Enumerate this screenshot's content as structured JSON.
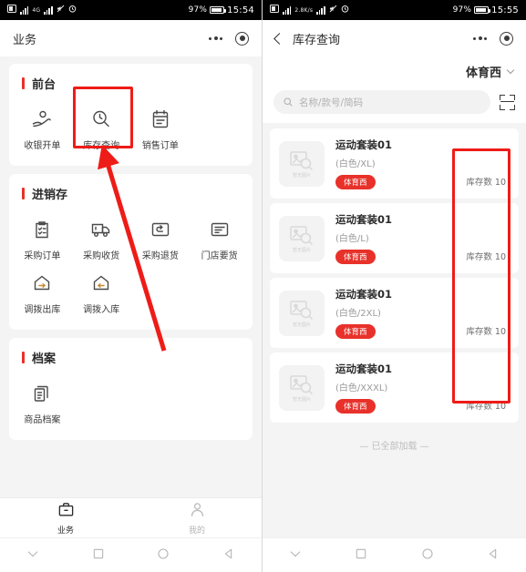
{
  "left_screen": {
    "status_bar": {
      "battery_pct": "97%",
      "time": "15:54",
      "network": "4G"
    },
    "header": {
      "title": "业务",
      "more_icon": "more-dots-icon",
      "target_icon": "target-icon"
    },
    "sections": [
      {
        "title": "前台",
        "items": [
          {
            "label": "收银开单",
            "icon": "hand-coin-icon",
            "highlighted": false
          },
          {
            "label": "库存查询",
            "icon": "search-stock-icon",
            "highlighted": true
          },
          {
            "label": "销售订单",
            "icon": "clipboard-calendar-icon",
            "highlighted": false
          }
        ]
      },
      {
        "title": "进销存",
        "items": [
          {
            "label": "采购订单",
            "icon": "clipboard-check-icon",
            "highlighted": false
          },
          {
            "label": "采购收货",
            "icon": "truck-icon",
            "highlighted": false
          },
          {
            "label": "采购退货",
            "icon": "box-return-icon",
            "highlighted": false
          },
          {
            "label": "门店要货",
            "icon": "box-request-icon",
            "highlighted": false
          },
          {
            "label": "调拨出库",
            "icon": "house-arrow-right-icon",
            "highlighted": false
          },
          {
            "label": "调拨入库",
            "icon": "house-arrow-left-icon",
            "highlighted": false
          }
        ]
      },
      {
        "title": "档案",
        "items": [
          {
            "label": "商品档案",
            "icon": "documents-icon",
            "highlighted": false
          }
        ]
      }
    ],
    "tabbar": [
      {
        "label": "业务",
        "icon": "briefcase-icon",
        "active": true
      },
      {
        "label": "我的",
        "icon": "person-icon",
        "active": false
      }
    ],
    "navbar": [
      {
        "icon": "chevron-down-icon"
      },
      {
        "icon": "square-icon"
      },
      {
        "icon": "circle-icon"
      },
      {
        "icon": "triangle-back-icon"
      }
    ]
  },
  "right_screen": {
    "status_bar": {
      "battery_pct": "97%",
      "time": "15:55",
      "network": "2.8K/s"
    },
    "header": {
      "title": "库存查询",
      "back_icon": "back-chevron-icon",
      "more_icon": "more-dots-icon",
      "target_icon": "target-icon"
    },
    "store_selector": {
      "name": "体育西",
      "chevron_icon": "chevron-down-icon"
    },
    "search": {
      "placeholder": "名称/款号/简码",
      "value": "",
      "search_icon": "search-icon",
      "scan_icon": "scan-code-icon"
    },
    "products": [
      {
        "name": "运动套装01",
        "spec": "(白色/XL)",
        "badge": "体育西",
        "stock": "库存数 10",
        "thumb_text": "暂无图片"
      },
      {
        "name": "运动套装01",
        "spec": "(白色/L)",
        "badge": "体育西",
        "stock": "库存数 10",
        "thumb_text": "暂无图片"
      },
      {
        "name": "运动套装01",
        "spec": "(白色/2XL)",
        "badge": "体育西",
        "stock": "库存数 10",
        "thumb_text": "暂无图片"
      },
      {
        "name": "运动套装01",
        "spec": "(白色/XXXL)",
        "badge": "体育西",
        "stock": "库存数 10",
        "thumb_text": "暂无图片"
      }
    ],
    "footer": {
      "loaded_all": "— 已全部加载 —"
    },
    "navbar": [
      {
        "icon": "chevron-down-icon"
      },
      {
        "icon": "square-icon"
      },
      {
        "icon": "circle-icon"
      },
      {
        "icon": "triangle-back-icon"
      }
    ]
  },
  "annotations": {
    "accent_color": "#ee1c18",
    "box_left": {
      "target": "库存查询"
    },
    "box_right": {
      "target": "库存数 10"
    },
    "arrow": {
      "points_to": "库存查询"
    }
  }
}
